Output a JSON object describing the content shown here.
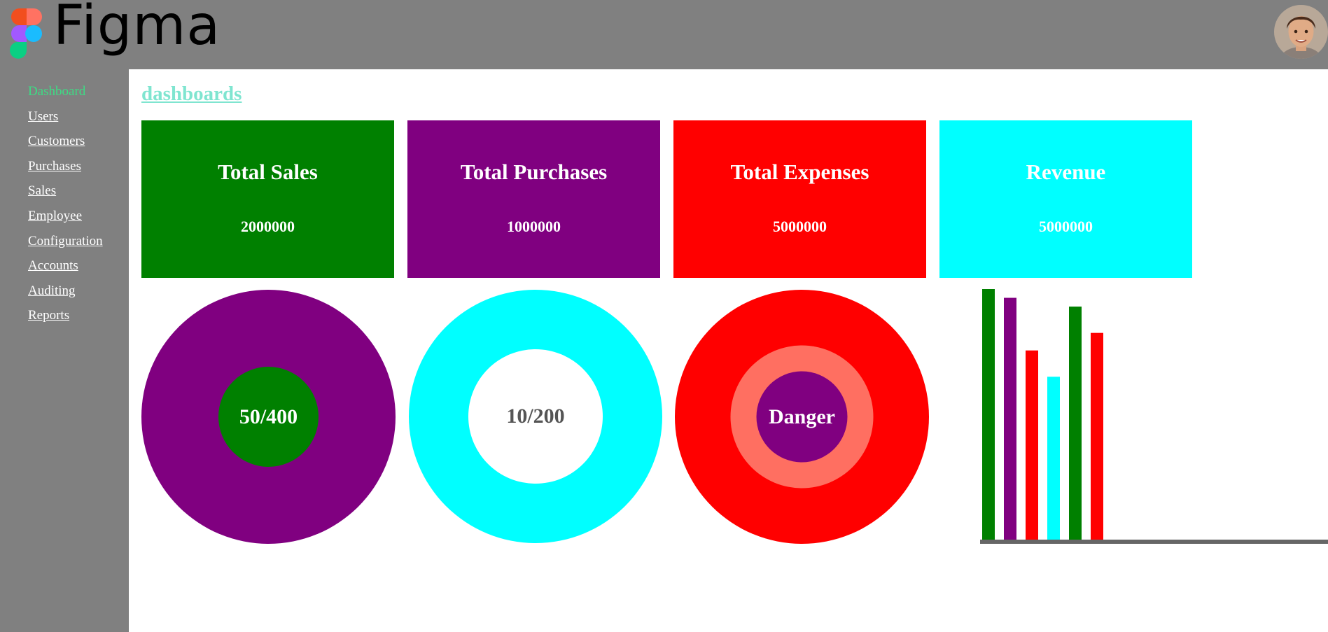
{
  "app": {
    "name": "Figma",
    "logo_icon": "figma-logo-icon",
    "avatar_icon": "user-avatar"
  },
  "sidebar": {
    "items": [
      {
        "label": "Dashboard",
        "active": true
      },
      {
        "label": "Users"
      },
      {
        "label": "Customers"
      },
      {
        "label": "Purchases"
      },
      {
        "label": "Sales"
      },
      {
        "label": "Employee"
      },
      {
        "label": "Configuration"
      },
      {
        "label": "Accounts"
      },
      {
        "label": "Auditing"
      },
      {
        "label": "Reports"
      }
    ],
    "active_color": "#3ddc84"
  },
  "main": {
    "title": "dashboards",
    "title_color": "#7fe5d0",
    "cards": [
      {
        "title": "Total Sales",
        "value": "2000000",
        "color": "#008000"
      },
      {
        "title": "Total Purchases",
        "value": "1000000",
        "color": "#800080"
      },
      {
        "title": "Total Expenses",
        "value": "5000000",
        "color": "#ff0000"
      },
      {
        "title": "Revenue",
        "value": "5000000",
        "color": "#00ffff"
      }
    ],
    "donuts": [
      {
        "label": "50/400",
        "outer_color": "#800080",
        "inner_color": "#008000",
        "label_color": "#ffffff"
      },
      {
        "label": "10/200",
        "outer_color": "#00ffff",
        "inner_color": "#ffffff",
        "label_color": "#555555"
      },
      {
        "label": "Danger",
        "outer_color": "#ff0000",
        "ring_color": "#ff6f61",
        "inner_color": "#800080",
        "label_color": "#ffffff"
      }
    ]
  },
  "chart_data": {
    "type": "bar",
    "values": [
      100,
      96.5,
      75.5,
      65,
      93,
      82.5
    ],
    "colors": [
      "#008000",
      "#800080",
      "#ff0000",
      "#00ffff",
      "#008000",
      "#ff0000"
    ],
    "axis_color": "#666666",
    "ylim": [
      0,
      100
    ]
  }
}
